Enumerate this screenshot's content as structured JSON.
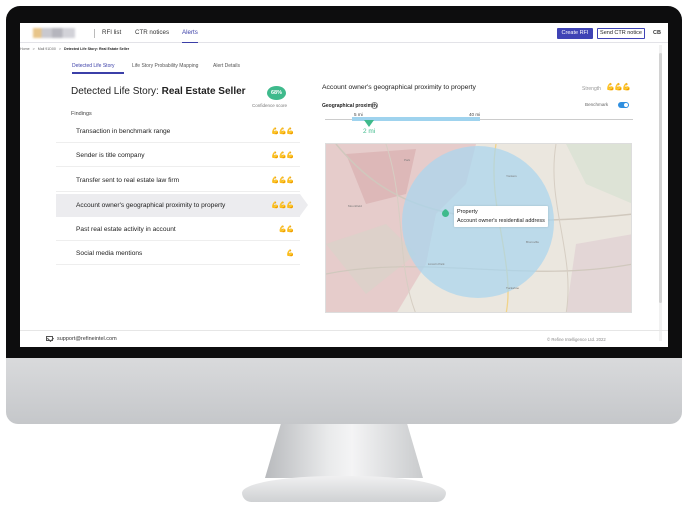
{
  "header": {
    "nav": [
      "RFI list",
      "CTR notices",
      "Alerts"
    ],
    "active_nav": "Alerts",
    "create_button": "Create RFI",
    "send_button": "Send CTR notice",
    "avatar": "CB"
  },
  "breadcrumb": [
    "Home",
    ">",
    "Mall 91D00",
    ">",
    "Detected Life Story: Real Estate Seller"
  ],
  "tabs": [
    "Detected Life Story",
    "Life Story Probability Mapping",
    "Alert Details"
  ],
  "active_tab": "Detected Life Story",
  "story": {
    "title_prefix": "Detected Life Story:",
    "title_bold": "Real Estate Seller",
    "confidence_value": "68%",
    "confidence_label": "Confidence score",
    "findings_label": "Findings"
  },
  "findings": [
    {
      "label": "Transaction in benchmark range",
      "strength": "💪💪💪"
    },
    {
      "label": "Sender is title company",
      "strength": "💪💪💪"
    },
    {
      "label": "Transfer sent to real estate law firm",
      "strength": "💪💪💪"
    },
    {
      "label": "Account owner's geographical proximity to property",
      "strength": "💪💪💪"
    },
    {
      "label": "Past real estate activity in account",
      "strength": "💪💪"
    },
    {
      "label": "Social media mentions",
      "strength": "💪"
    }
  ],
  "selected_finding": 3,
  "detail": {
    "title": "Account owner's geographical proximity to property",
    "strength_label": "Strength",
    "strength": "💪💪💪",
    "proximity_label": "Geographical proximity",
    "benchmark_label": "Benchmark",
    "benchmark_on": true,
    "scale_min": "5 mi",
    "scale_max": "40 mi",
    "value_label": "2 mi",
    "value_fraction": 0.1,
    "tooltip_line1": "Property",
    "tooltip_line2": "Account owner's residential address"
  },
  "map_labels": [
    "Park",
    "Mountfield",
    "Yonkers",
    "Bronxville",
    "Lincoln Park",
    "Tuckahoe"
  ],
  "colors": {
    "accent": "#3f43b5",
    "confidence": "#3fba8c",
    "strength": "#f3a626",
    "radius_fill": "#a9d6ef"
  },
  "footer": {
    "email": "support@refineintel.com",
    "copyright": "© Refine Intelligence Ltd. 2022"
  }
}
